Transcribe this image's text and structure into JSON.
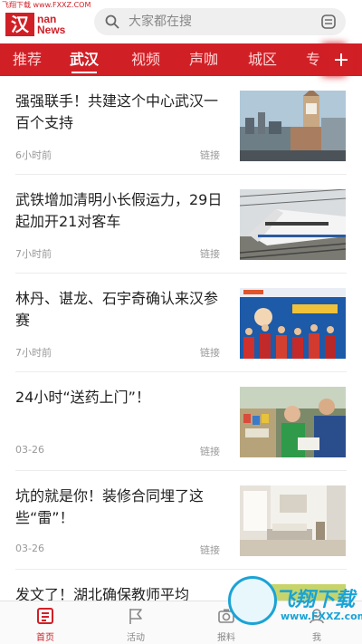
{
  "watermark_top": "飞翔下载 www.FXXZ.COM",
  "logo": {
    "mark": "汉",
    "line1": "nan",
    "line2": "News"
  },
  "search": {
    "placeholder": "大家都在搜"
  },
  "tabs": [
    {
      "label": "推荐",
      "active": false
    },
    {
      "label": "武汉",
      "active": true
    },
    {
      "label": "视频",
      "active": false
    },
    {
      "label": "声咖",
      "active": false
    },
    {
      "label": "城区",
      "active": false
    },
    {
      "label": "专",
      "active": false
    }
  ],
  "feed": [
    {
      "title": "强强联手！共建这个中心武汉一百个支持",
      "date": "6小时前",
      "link": "链接",
      "image": "city-skyline-clock-tower"
    },
    {
      "title": "武铁增加清明小长假运力，29日起加开21对客车",
      "date": "7小时前",
      "link": "链接",
      "image": "high-speed-train"
    },
    {
      "title": "林丹、谌龙、石宇奇确认来汉参赛",
      "date": "7小时前",
      "link": "链接",
      "image": "badminton-poster"
    },
    {
      "title": "24小时“送药上门”！",
      "date": "03-26",
      "link": "链接",
      "image": "medicine-delivery"
    },
    {
      "title": "坑的就是你！装修合同埋了这些“雷”！",
      "date": "03-26",
      "link": "链接",
      "image": "bright-living-room"
    },
    {
      "title": "发文了！湖北确保教师平均",
      "date": "",
      "link": "",
      "image": "partial-photo"
    }
  ],
  "bottom_nav": [
    {
      "label": "首页",
      "icon": "home-news-icon",
      "active": true
    },
    {
      "label": "活动",
      "icon": "flag-icon",
      "active": false
    },
    {
      "label": "报料",
      "icon": "camera-icon",
      "active": false
    },
    {
      "label": "我",
      "icon": "user-icon",
      "active": false
    }
  ],
  "watermark_badge": {
    "text": "飞翔下载",
    "url": "www.FXXZ.com"
  },
  "colors": {
    "brand_red": "#d11f26",
    "watermark_blue": "#1aa3d6"
  }
}
